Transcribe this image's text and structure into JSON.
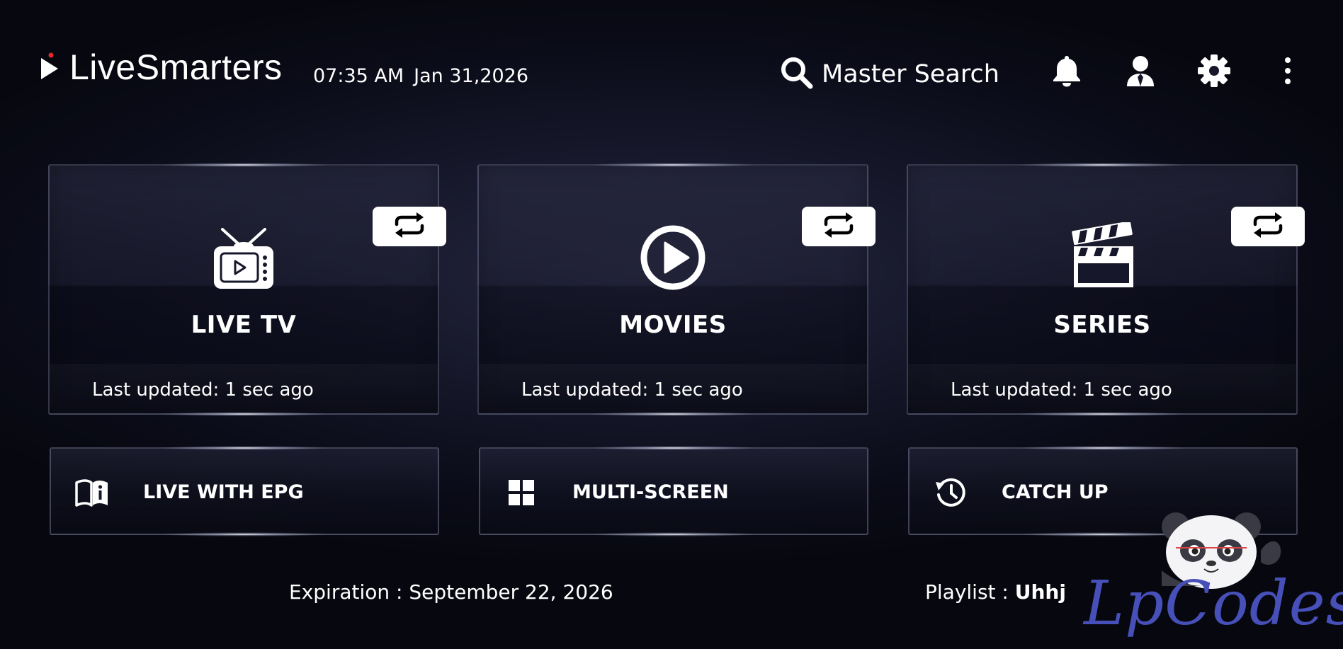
{
  "header": {
    "brand": "LiveSmarters",
    "time": "07:35 AM",
    "date": "Jan 31,2026",
    "search_label": "Master Search",
    "icons": [
      "bell-icon",
      "user-icon",
      "gear-icon",
      "kebab-menu-icon"
    ]
  },
  "cards": [
    {
      "title": "LIVE TV",
      "icon": "tv-icon",
      "updated": "Last updated: 1 sec ago",
      "refresh_icon": "refresh-icon"
    },
    {
      "title": "MOVIES",
      "icon": "play-circle-icon",
      "updated": "Last updated: 1 sec ago",
      "refresh_icon": "refresh-icon"
    },
    {
      "title": "SERIES",
      "icon": "clapperboard-icon",
      "updated": "Last updated: 1 sec ago",
      "refresh_icon": "refresh-icon"
    }
  ],
  "shortcuts": [
    {
      "label": "LIVE WITH EPG",
      "icon": "book-info-icon"
    },
    {
      "label": "MULTI-SCREEN",
      "icon": "grid-icon"
    },
    {
      "label": "CATCH UP",
      "icon": "history-icon"
    }
  ],
  "footer": {
    "expiration_label": "Expiration :",
    "expiration_value": "September 22, 2026",
    "playlist_label": "Playlist :",
    "playlist_value": "Uhhj"
  },
  "watermark": {
    "text": "LpCodes",
    "icon": "panda-icon"
  },
  "colors": {
    "background": "#0a0b17",
    "accent_red": "#e8262d",
    "watermark": "#4750b8",
    "text": "#ffffff"
  }
}
